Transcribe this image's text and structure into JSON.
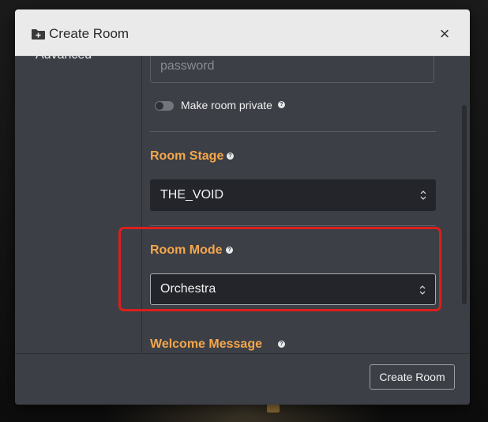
{
  "modal": {
    "title": "Create Room",
    "title_icon": "folder-plus-icon",
    "close_label": "×"
  },
  "sidebar": {
    "items": [
      {
        "label": "Advanced"
      }
    ]
  },
  "form": {
    "password": {
      "placeholder": "password",
      "value": ""
    },
    "private_toggle": {
      "label": "Make room private",
      "checked": false
    },
    "stage": {
      "label": "Room Stage",
      "value": "THE_VOID"
    },
    "mode": {
      "label": "Room Mode",
      "value": "Orchestra"
    },
    "welcome": {
      "label": "Welcome Message"
    }
  },
  "footer": {
    "create_label": "Create Room"
  },
  "colors": {
    "accent": "#f5a74b",
    "highlight": "#d9201e",
    "modal_bg": "#3c3f46",
    "header_bg": "#eaeaea"
  }
}
